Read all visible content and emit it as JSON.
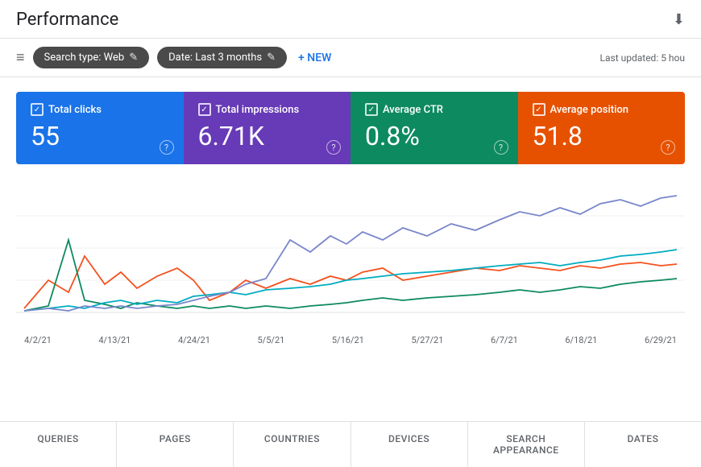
{
  "header": {
    "title": "Performance",
    "download_icon": "⬇"
  },
  "toolbar": {
    "filter_icon": "≡",
    "chips": [
      {
        "label": "Search type: Web",
        "icon": "✎"
      },
      {
        "label": "Date: Last 3 months",
        "icon": "✎"
      }
    ],
    "new_button_label": "+ NEW",
    "last_updated": "Last updated: 5 hou"
  },
  "metrics": [
    {
      "id": "total-clicks",
      "label": "Total clicks",
      "value": "55",
      "color": "blue"
    },
    {
      "id": "total-impressions",
      "label": "Total impressions",
      "value": "6.71K",
      "color": "purple"
    },
    {
      "id": "average-ctr",
      "label": "Average CTR",
      "value": "0.8%",
      "color": "green"
    },
    {
      "id": "average-position",
      "label": "Average position",
      "value": "51.8",
      "color": "orange"
    }
  ],
  "chart": {
    "dates": [
      "4/2/21",
      "4/13/21",
      "4/24/21",
      "5/5/21",
      "5/16/21",
      "5/27/21",
      "6/7/21",
      "6/18/21",
      "6/29/21"
    ],
    "lines": {
      "blue": "blue-purple",
      "orange": "orange",
      "green": "green",
      "teal": "teal"
    }
  },
  "bottom_tabs": [
    {
      "label": "QUERIES"
    },
    {
      "label": "PAGES"
    },
    {
      "label": "COUNTRIES"
    },
    {
      "label": "DEVICES"
    },
    {
      "label": "SEARCH APPEARANCE"
    },
    {
      "label": "DATES"
    }
  ]
}
